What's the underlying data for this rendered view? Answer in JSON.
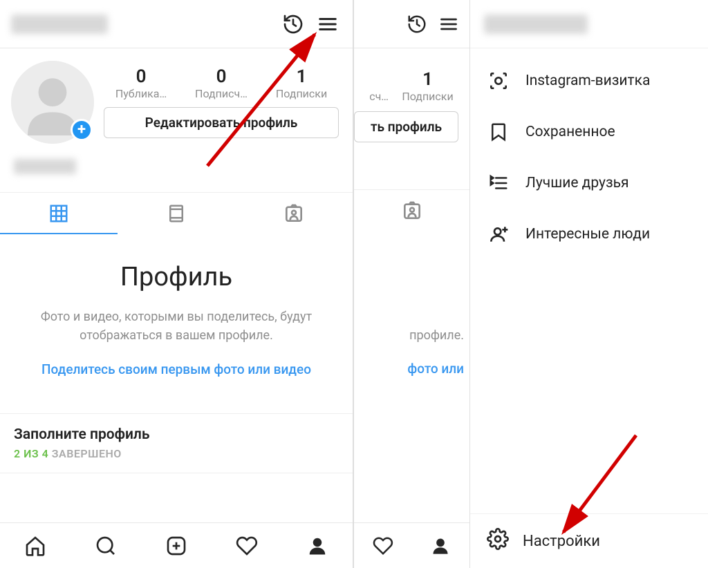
{
  "left": {
    "stats": {
      "posts": {
        "num": "0",
        "label": "Публика…"
      },
      "followers": {
        "num": "0",
        "label": "Подписч…"
      },
      "following": {
        "num": "1",
        "label": "Подписки"
      }
    },
    "edit_profile": "Редактировать профиль",
    "profile_title": "Профиль",
    "profile_desc": "Фото и видео, которыми вы поделитесь, будут отображаться в вашем профиле.",
    "share_link": "Поделитесь своим первым фото или видео",
    "fill": {
      "title": "Заполните профиль",
      "done_num": "2 ИЗ 4",
      "done_label": " ЗАВЕРШЕНО"
    }
  },
  "right_partial": {
    "following": {
      "num": "1",
      "label": "Подписки"
    },
    "followers_lbl_cut": "сч…",
    "edit_cut": "ть профиль",
    "desc_cut": "профиле.",
    "link_cut": "фото или"
  },
  "drawer": {
    "items": [
      {
        "label": "Instagram-визитка"
      },
      {
        "label": "Сохраненное"
      },
      {
        "label": "Лучшие друзья"
      },
      {
        "label": "Интересные люди"
      }
    ],
    "settings": "Настройки"
  }
}
